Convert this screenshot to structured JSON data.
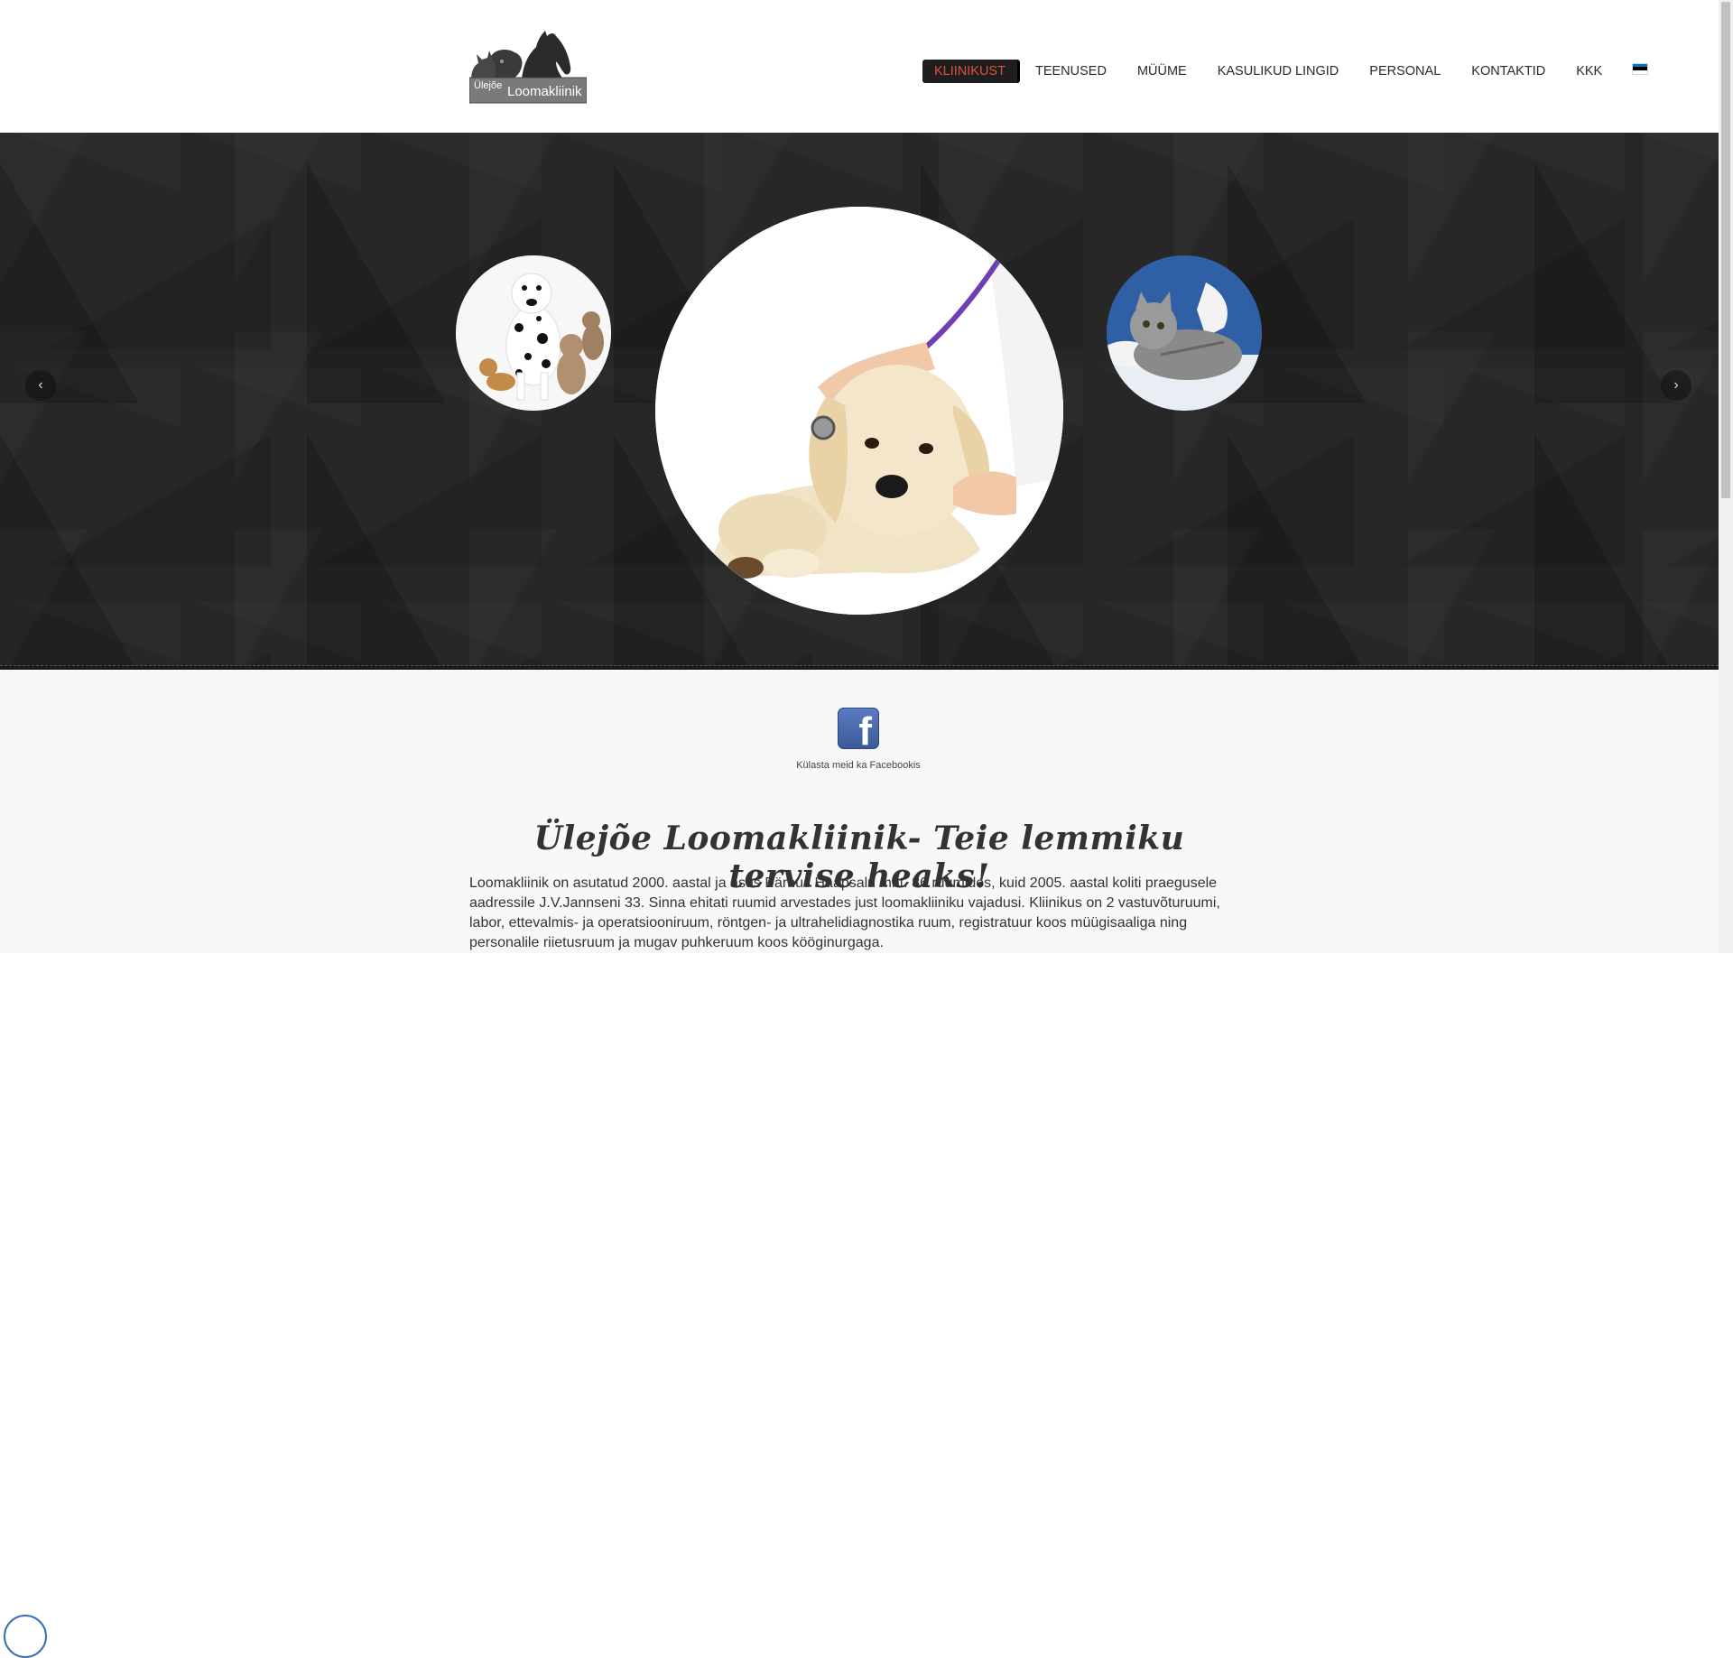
{
  "logo": {
    "small_text": "Ülejõe",
    "big_text": "Loomakliinik"
  },
  "nav": {
    "items": [
      {
        "label": "KLIINIKUST",
        "active": true
      },
      {
        "label": "TEENUSED"
      },
      {
        "label": "MÜÜME"
      },
      {
        "label": "KASULIKUD LINGID"
      },
      {
        "label": "PERSONAL"
      },
      {
        "label": "KONTAKTID"
      },
      {
        "label": "KKK"
      }
    ],
    "flag_colors": [
      "#0072ce",
      "#000000",
      "#ffffff"
    ]
  },
  "slider": {
    "prev_icon": "chevron-left-icon",
    "next_icon": "chevron-right-icon",
    "prev_glyph": "‹",
    "next_glyph": "›"
  },
  "content": {
    "facebook_caption": "Külasta meid ka Facebookis",
    "headline": "Ülejõe Loomakliinik- Teie lemmiku tervise heaks!",
    "paragraph": "Loomakliinik on asutatud 2000. aastal ja asus Pärnus Haapsalu mnt. 86 ruumides, kuid 2005. aastal koliti praegusele aadressile J.V.Jannseni 33. Sinna ehitati ruumid arvestades just loomakliiniku vajadusi. Kliinikus on 2 vastuvõturuumi, labor, ettevalmis- ja operatsiooniruum, röntgen- ja ultrahelidiagnostika ruum, registratuur koos müügisaaliga ning personalile riietusruum ja mugav puhkeruum koos kööginurgaga."
  },
  "colors": {
    "accent": "#e3503b",
    "hero_bg": "#272727",
    "facebook": "#3b5998"
  }
}
